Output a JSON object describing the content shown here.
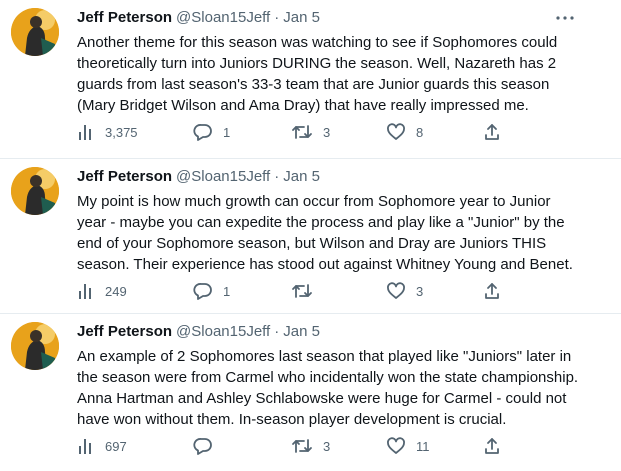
{
  "tweets": [
    {
      "name": "Jeff Peterson",
      "handle": "@Sloan15Jeff",
      "separator": "·",
      "date": "Jan 5",
      "lines": [
        "Another theme for this season was watching to see if Sophomores could",
        "theoretically turn into Juniors DURING the season.  Well, Nazareth has 2",
        "guards from last season's 33-3 team that are Junior guards this season",
        "(Mary Bridget Wilson and Ama Dray) that have really impressed me."
      ],
      "views": "3,375",
      "replies": "1",
      "retweets": "3",
      "likes": "8"
    },
    {
      "name": "Jeff Peterson",
      "handle": "@Sloan15Jeff",
      "separator": "·",
      "date": "Jan 5",
      "lines": [
        "My point is how much growth can occur from Sophomore year to Junior",
        "year - maybe you can expedite the process and play like a \"Junior\" by the",
        "end of your Sophomore season, but Wilson and Dray are Juniors THIS",
        "season. Their experience has stood out against Whitney Young and Benet."
      ],
      "views": "249",
      "replies": "1",
      "retweets": "",
      "likes": "3"
    },
    {
      "name": "Jeff Peterson",
      "handle": "@Sloan15Jeff",
      "separator": "·",
      "date": "Jan 5",
      "lines": [
        "An example of 2 Sophomores last season that played like \"Juniors\" later in",
        "the season were from Carmel who incidentally won the state championship.",
        "Anna Hartman and Ashley Schlabowske were huge for Carmel - could not",
        "have won without them. In-season player development is crucial."
      ],
      "views": "697",
      "replies": "",
      "retweets": "3",
      "likes": "11"
    }
  ],
  "colors": {
    "text": "#0f1419",
    "secondary": "#536471",
    "divider": "#e6ecf0",
    "avatar_bg": "#e8a21b"
  },
  "icons": [
    "views-icon",
    "reply-icon",
    "retweet-icon",
    "like-icon",
    "share-icon",
    "more-icon"
  ]
}
